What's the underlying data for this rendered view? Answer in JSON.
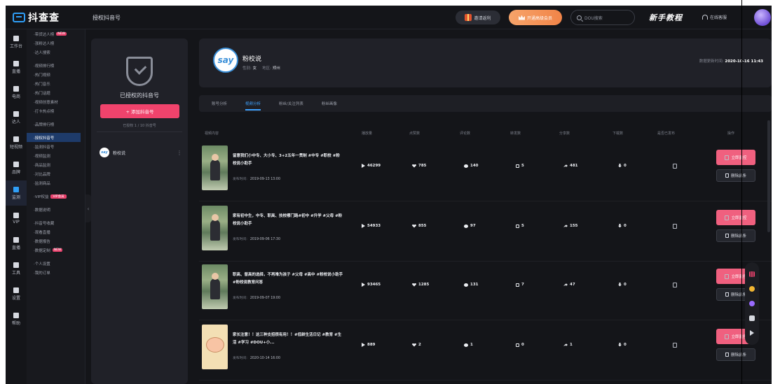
{
  "app": {
    "logo_text": "抖查查",
    "page_crumb": "授权抖音号"
  },
  "header": {
    "gift_label": "邀请返利",
    "vip_label": "开通高级会员",
    "search_placeholder": "DOU搜索",
    "tutorial": "新手教程",
    "service": "在线客服"
  },
  "leftnav": [
    {
      "label": "工作台",
      "icon": "grid-icon"
    },
    {
      "label": "直播",
      "icon": "live-icon"
    },
    {
      "label": "电商",
      "icon": "cart-icon"
    },
    {
      "label": "达人",
      "icon": "tiktok-icon"
    },
    {
      "label": "短视频",
      "icon": "video-icon"
    },
    {
      "label": "品牌",
      "icon": "brand-icon"
    },
    {
      "label": "监测",
      "icon": "monitor-icon"
    },
    {
      "label": "VIP",
      "icon": "crown-icon"
    },
    {
      "label": "直播",
      "icon": "bag-icon"
    },
    {
      "label": "工具",
      "icon": "tool-icon"
    },
    {
      "label": "设置",
      "icon": "gear-icon"
    },
    {
      "label": "帮助",
      "icon": "help-icon"
    }
  ],
  "subnav": [
    {
      "label": "·带货达人榜",
      "tag": "NEW"
    },
    {
      "label": "·涨粉达人榜"
    },
    {
      "label": "·达人搜索"
    },
    {
      "label": "·视频排行榜",
      "gap": true
    },
    {
      "label": "·热门视频"
    },
    {
      "label": "·热门音乐"
    },
    {
      "label": "·热门话题"
    },
    {
      "label": "·视频创意素材"
    },
    {
      "label": "·打卡热点榜"
    },
    {
      "label": "·品牌排行榜",
      "gap": true
    },
    {
      "label": "·授权抖音号",
      "gap": true,
      "active": true
    },
    {
      "label": "·监测抖音号"
    },
    {
      "label": "·视频监测"
    },
    {
      "label": "·商品监测"
    },
    {
      "label": "·对比品牌"
    },
    {
      "label": "·监测商品"
    },
    {
      "label": "·VIP权益",
      "tag": "VIP会员",
      "gap": true
    },
    {
      "label": "·数据说明",
      "gap": true
    },
    {
      "label": "·抖音号收藏",
      "gap": true
    },
    {
      "label": "·观看直播"
    },
    {
      "label": "·数据报告"
    },
    {
      "label": "·数据定制",
      "tag": "NEW"
    },
    {
      "label": "·个人设置",
      "gap": true
    },
    {
      "label": "·我的订单"
    }
  ],
  "account_panel": {
    "title": "已授权的抖音号",
    "add_button": "+ 添加抖音号",
    "count_text": "已授权 1 / 10 抖音号",
    "accounts": [
      {
        "name": "粉校说",
        "avatar": "say"
      }
    ]
  },
  "profile": {
    "avatar": "say",
    "name": "粉校说",
    "gender_label": "性别:",
    "gender": "女",
    "region_label": "地区:",
    "region": "郑州",
    "update_label": "数据更新时间:",
    "update_time": "2020-10-16 11:43"
  },
  "tabs": [
    {
      "label": "账号分析"
    },
    {
      "label": "视频分析",
      "active": true
    },
    {
      "label": "粉丝/关注列表"
    },
    {
      "label": "粉丝画像"
    }
  ],
  "table": {
    "headers": [
      "视频内容",
      "播放量",
      "点赞数",
      "评论数",
      "转发数",
      "分享数",
      "下载数",
      "是否已发布",
      "操作"
    ],
    "rows": [
      {
        "thumb": "green",
        "title": "留意我们小中专、大小专、3+2五年一贯制 #中专 #职校 #粉校说小助手",
        "time_label": "发布时间:",
        "time": "2019-09-13 13:00",
        "plays": "46299",
        "likes": "785",
        "comments": "140",
        "reposts": "5",
        "shares": "481",
        "downloads": "0"
      },
      {
        "thumb": "green",
        "title": "家有初中生，中专、职高、技校哪门路#初中 #升学 #父母 #粉校说小助手",
        "time_label": "发布时间:",
        "time": "2019-09-06 17:30",
        "plays": "54933",
        "likes": "855",
        "comments": "97",
        "reposts": "5",
        "shares": "155",
        "downloads": "0"
      },
      {
        "thumb": "green",
        "title": "职高、普高的选择，不再难为孩子 #父母 #高中 #粉校说小助手 #粉校说教育问答",
        "time_label": "发布时间:",
        "time": "2019-09-07 19:00",
        "plays": "93465",
        "likes": "1285",
        "comments": "131",
        "reposts": "7",
        "shares": "47",
        "downloads": "0"
      },
      {
        "thumb": "beige",
        "title": "家长注意！！这三种支招很有用！！#低龄生活日记 #教育 #生活 #学习 #DOU+小...",
        "time_label": "发布时间:",
        "time": "2020-10-14 16:00",
        "plays": "889",
        "likes": "2",
        "comments": "1",
        "reposts": "0",
        "shares": "1",
        "downloads": "0"
      }
    ],
    "monitor_label": "立即监控",
    "delete_label": "删除此条"
  },
  "dock": [
    "bar-chart-icon",
    "coin-icon",
    "heart-icon",
    "lock-icon",
    "play-icon"
  ]
}
